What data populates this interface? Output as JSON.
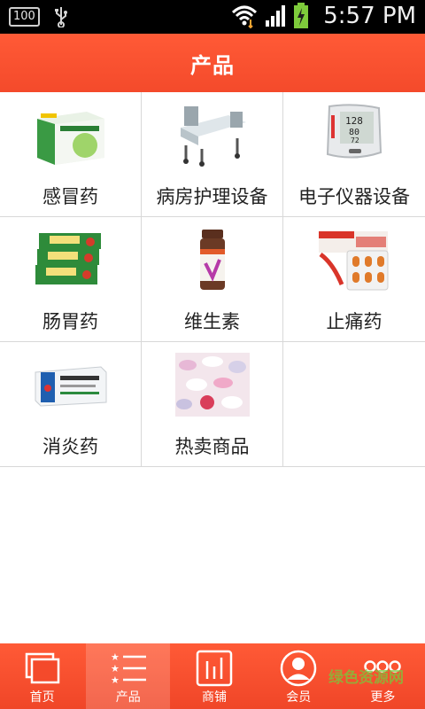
{
  "status_bar": {
    "battery_level_text": "100",
    "time": "5:57 PM"
  },
  "header": {
    "title": "产品"
  },
  "products": [
    {
      "label": "感冒药",
      "icon": "cold-medicine-box-icon"
    },
    {
      "label": "病房护理设备",
      "icon": "hospital-bed-icon"
    },
    {
      "label": "电子仪器设备",
      "icon": "blood-pressure-monitor-icon"
    },
    {
      "label": "肠胃药",
      "icon": "stomach-medicine-boxes-icon"
    },
    {
      "label": "维生素",
      "icon": "vitamin-bottle-icon"
    },
    {
      "label": "止痛药",
      "icon": "painkiller-pack-icon"
    },
    {
      "label": "消炎药",
      "icon": "anti-inflammatory-box-icon"
    },
    {
      "label": "热卖商品",
      "icon": "pills-pile-icon"
    }
  ],
  "bottom_nav": [
    {
      "label": "首页",
      "icon": "home-pages-icon"
    },
    {
      "label": "产品",
      "icon": "product-list-icon"
    },
    {
      "label": "商铺",
      "icon": "shop-chart-icon"
    },
    {
      "label": "会员",
      "icon": "member-avatar-icon"
    },
    {
      "label": "更多",
      "icon": "more-dots-icon"
    }
  ],
  "watermark": "绿色资源网",
  "colors": {
    "accent": "#f44a2b",
    "status_bar": "#000000"
  }
}
